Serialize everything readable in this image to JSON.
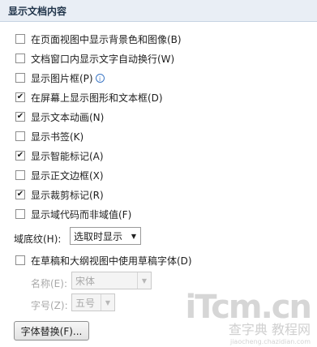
{
  "section": {
    "title": "显示文档内容"
  },
  "options": [
    {
      "label": "在页面视图中显示背景色和图像(B)",
      "checked": false
    },
    {
      "label": "文档窗口内显示文字自动换行(W)",
      "checked": false
    },
    {
      "label": "显示图片框(P)",
      "checked": false,
      "info_icon": "info-icon"
    },
    {
      "label": "在屏幕上显示图形和文本框(D)",
      "checked": true
    },
    {
      "label": "显示文本动画(N)",
      "checked": true
    },
    {
      "label": "显示书签(K)",
      "checked": false
    },
    {
      "label": "显示智能标记(A)",
      "checked": true
    },
    {
      "label": "显示正文边框(X)",
      "checked": false
    },
    {
      "label": "显示裁剪标记(R)",
      "checked": true
    },
    {
      "label": "显示域代码而非域值(F)",
      "checked": false
    }
  ],
  "field_shading": {
    "label": "域底纹(H):",
    "value": "选取时显示"
  },
  "draft_font": {
    "label": "在草稿和大纲视图中使用草稿字体(D)",
    "checked": false
  },
  "font_name": {
    "label": "名称(E):",
    "value": "宋体"
  },
  "font_size": {
    "label": "字号(Z):",
    "value": "五号"
  },
  "substitute_button": {
    "label": "字体替换(F)..."
  },
  "watermark": {
    "logo": "iTcm.cn",
    "cn": "查字典 教程网",
    "url": "jiaocheng.chazidian.com"
  }
}
